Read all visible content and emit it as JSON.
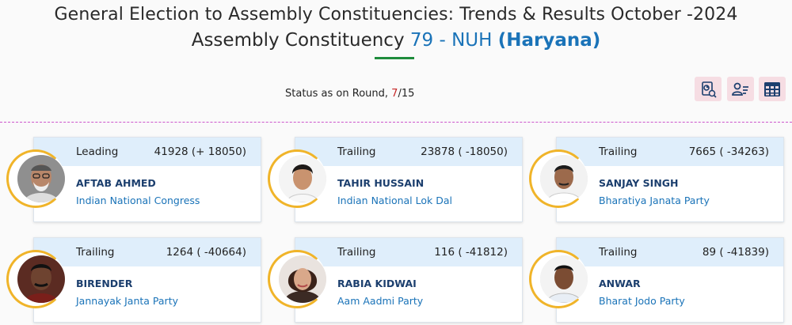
{
  "header": {
    "title": "General Election to Assembly Constituencies: Trends & Results October -2024",
    "subtitle_prefix": "Assembly Constituency",
    "constituency": "79 - NUH",
    "state": "(Haryana)"
  },
  "status": {
    "label": "Status as on Round,",
    "round": "7",
    "total": "/15"
  },
  "toolbar": {
    "icons": [
      "chart-list-icon",
      "candidate-list-icon",
      "table-grid-icon"
    ]
  },
  "candidates": [
    {
      "status": "Leading",
      "votes": "41928 (+ 18050)",
      "name": "AFTAB AHMED",
      "party": "Indian National Congress"
    },
    {
      "status": "Trailing",
      "votes": "23878 ( -18050)",
      "name": "TAHIR HUSSAIN",
      "party": "Indian National Lok Dal"
    },
    {
      "status": "Trailing",
      "votes": "7665 ( -34263)",
      "name": "SANJAY SINGH",
      "party": "Bharatiya Janata Party"
    },
    {
      "status": "Trailing",
      "votes": "1264 ( -40664)",
      "name": "BIRENDER",
      "party": "Jannayak Janta Party"
    },
    {
      "status": "Trailing",
      "votes": "116 ( -41812)",
      "name": "RABIA KIDWAI",
      "party": "Aam Aadmi Party"
    },
    {
      "status": "Trailing",
      "votes": "89 ( -41839)",
      "name": "ANWAR",
      "party": "Bharat Jodo Party"
    }
  ]
}
